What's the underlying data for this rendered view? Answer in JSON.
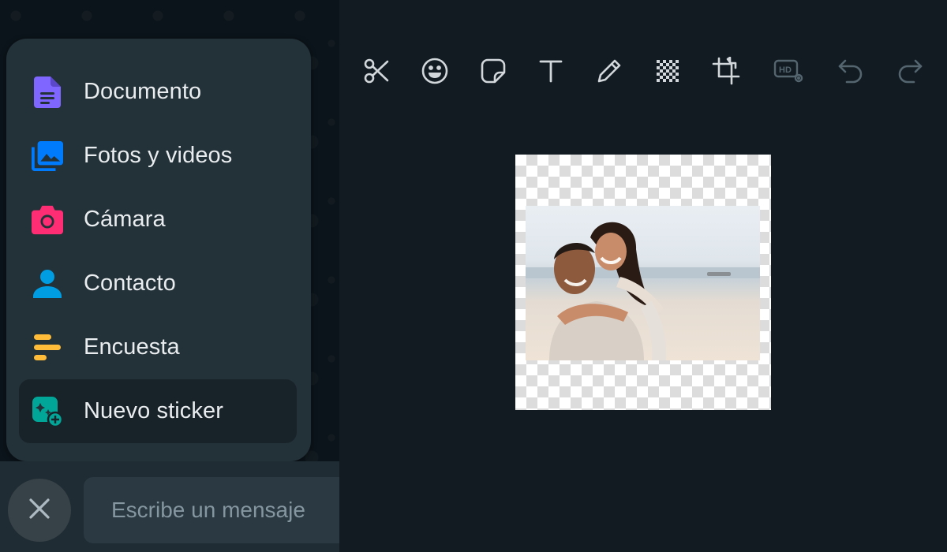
{
  "attach_menu": {
    "items": [
      {
        "label": "Documento",
        "icon": "document-icon",
        "color": "#7f66ff"
      },
      {
        "label": "Fotos y videos",
        "icon": "photos-icon",
        "color": "#007bfc"
      },
      {
        "label": "Cámara",
        "icon": "camera-icon",
        "color": "#ff2e74"
      },
      {
        "label": "Contacto",
        "icon": "contact-icon",
        "color": "#009de2"
      },
      {
        "label": "Encuesta",
        "icon": "poll-icon",
        "color": "#ffbc38"
      },
      {
        "label": "Nuevo sticker",
        "icon": "sticker-icon",
        "color": "#02a698"
      }
    ]
  },
  "composer": {
    "placeholder": "Escribe un mensaje"
  },
  "toolbar": {
    "tools": [
      "scissors-icon",
      "emoji-icon",
      "sticker-icon",
      "text-icon",
      "pencil-icon",
      "pixelate-icon",
      "crop-icon",
      "hd-settings-icon",
      "undo-icon",
      "redo-icon"
    ]
  },
  "colors": {
    "background": "#111b21",
    "menu": "#233138",
    "accent_text": "#e9edef",
    "placeholder": "#8696a0"
  }
}
